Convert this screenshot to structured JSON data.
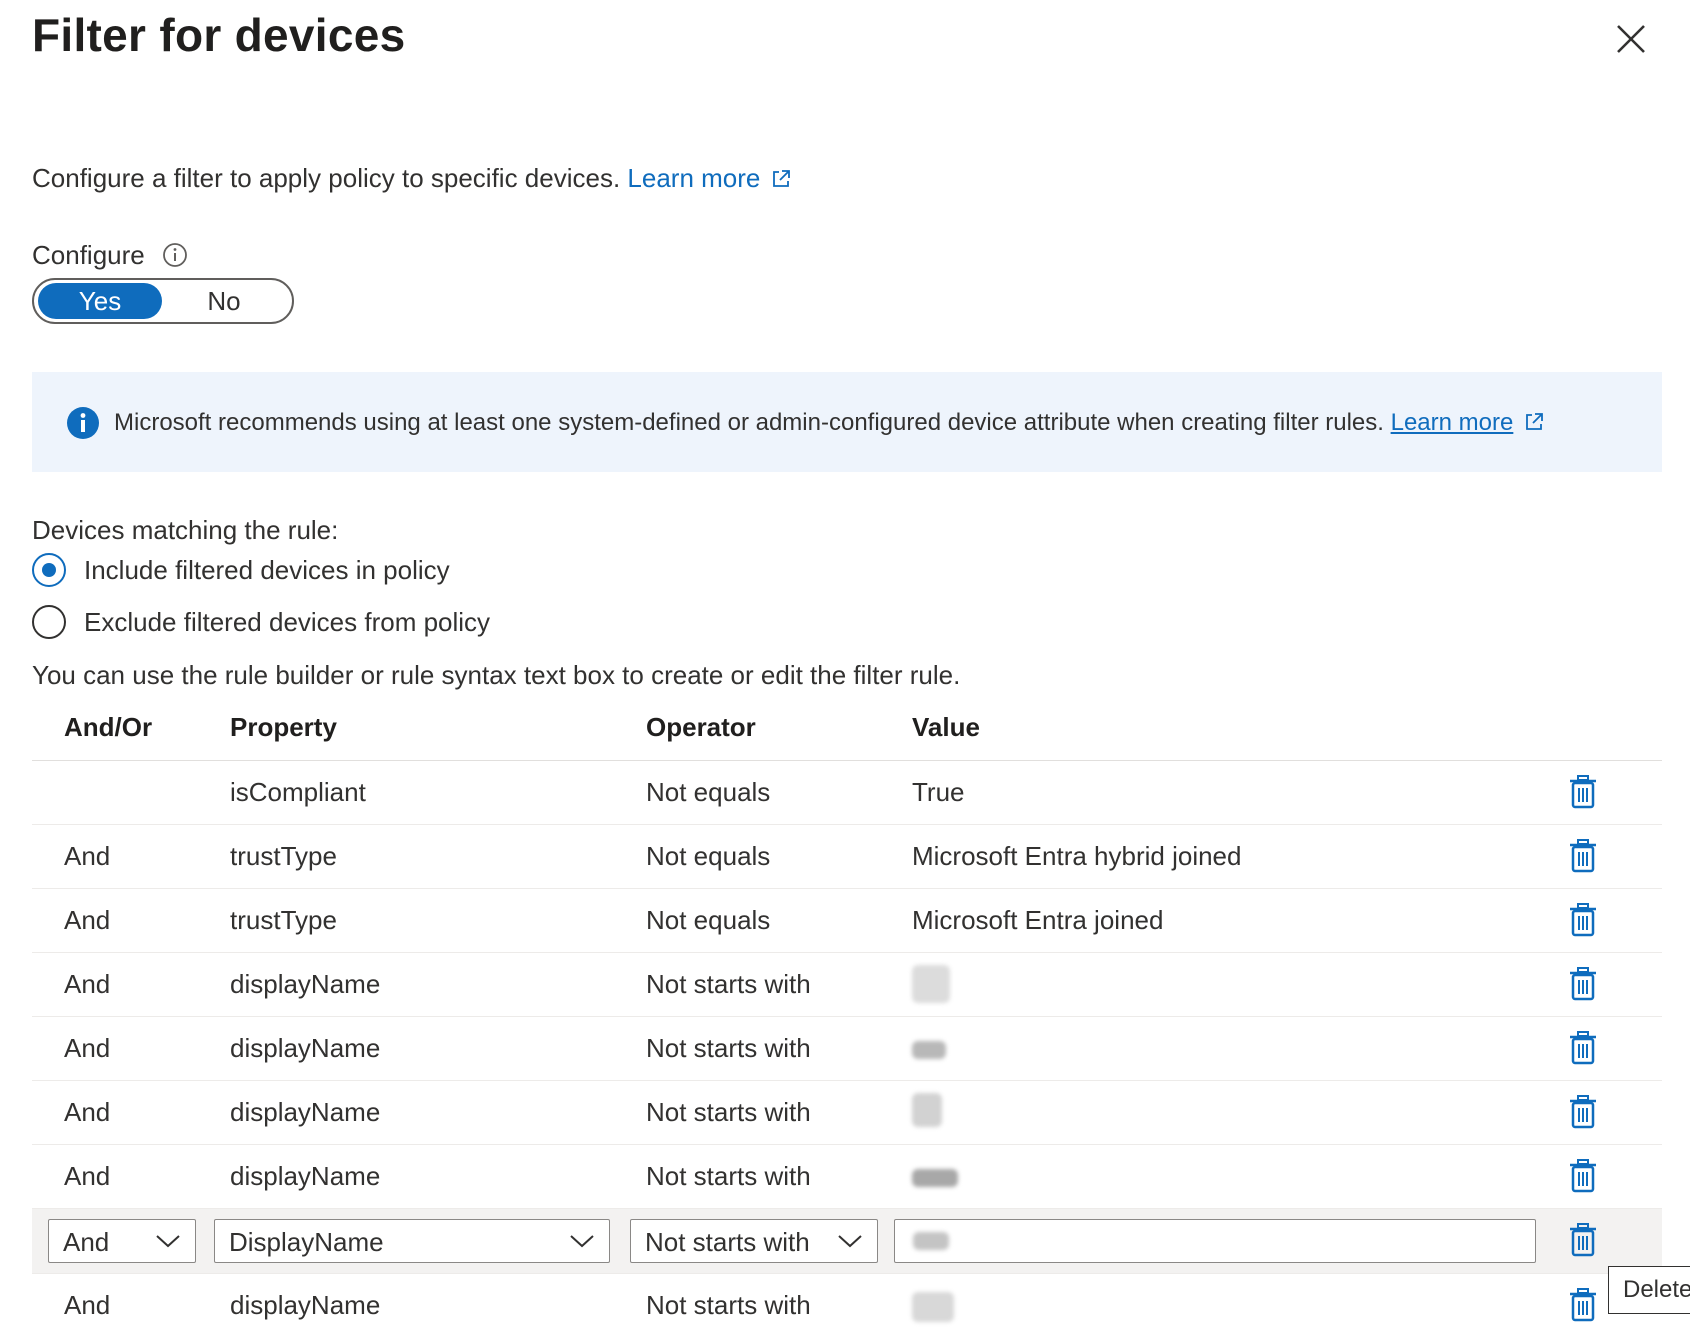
{
  "panel": {
    "title": "Filter for devices",
    "description": "Configure a filter to apply policy to specific devices.",
    "learn_more": "Learn more"
  },
  "configure": {
    "label": "Configure",
    "yes": "Yes",
    "no": "No",
    "selected": "Yes"
  },
  "banner": {
    "message": "Microsoft recommends using at least one system-defined or admin-configured device attribute when creating filter rules.",
    "learn_more": "Learn more"
  },
  "matching": {
    "label": "Devices matching the rule:",
    "include": "Include filtered devices in policy",
    "exclude": "Exclude filtered devices from policy",
    "selected": "include"
  },
  "hint": "You can use the rule builder or rule syntax text box to create or edit the filter rule.",
  "table": {
    "headers": {
      "andor": "And/Or",
      "property": "Property",
      "operator": "Operator",
      "value": "Value"
    },
    "rows": [
      {
        "andor": "",
        "property": "isCompliant",
        "operator": "Not equals",
        "value": "True"
      },
      {
        "andor": "And",
        "property": "trustType",
        "operator": "Not equals",
        "value": "Microsoft Entra hybrid joined"
      },
      {
        "andor": "And",
        "property": "trustType",
        "operator": "Not equals",
        "value": "Microsoft Entra joined"
      },
      {
        "andor": "And",
        "property": "displayName",
        "operator": "Not starts with",
        "value": ""
      },
      {
        "andor": "And",
        "property": "displayName",
        "operator": "Not starts with",
        "value": ""
      },
      {
        "andor": "And",
        "property": "displayName",
        "operator": "Not starts with",
        "value": ""
      },
      {
        "andor": "And",
        "property": "displayName",
        "operator": "Not starts with",
        "value": ""
      }
    ],
    "edit_row": {
      "andor": "And",
      "property": "DisplayName",
      "operator": "Not starts with",
      "value": ""
    },
    "last_row": {
      "andor": "And",
      "property": "displayName",
      "operator": "Not starts with",
      "value": ""
    }
  },
  "tooltip": "Delete",
  "icons": {
    "close": "close-icon",
    "external": "external-link-icon",
    "info": "info-icon",
    "trash": "trash-icon",
    "chevron": "chevron-down-icon"
  },
  "colors": {
    "accent": "#0f6cbd",
    "banner_bg": "#eef4fc",
    "edit_row_bg": "#f3f2f1"
  }
}
